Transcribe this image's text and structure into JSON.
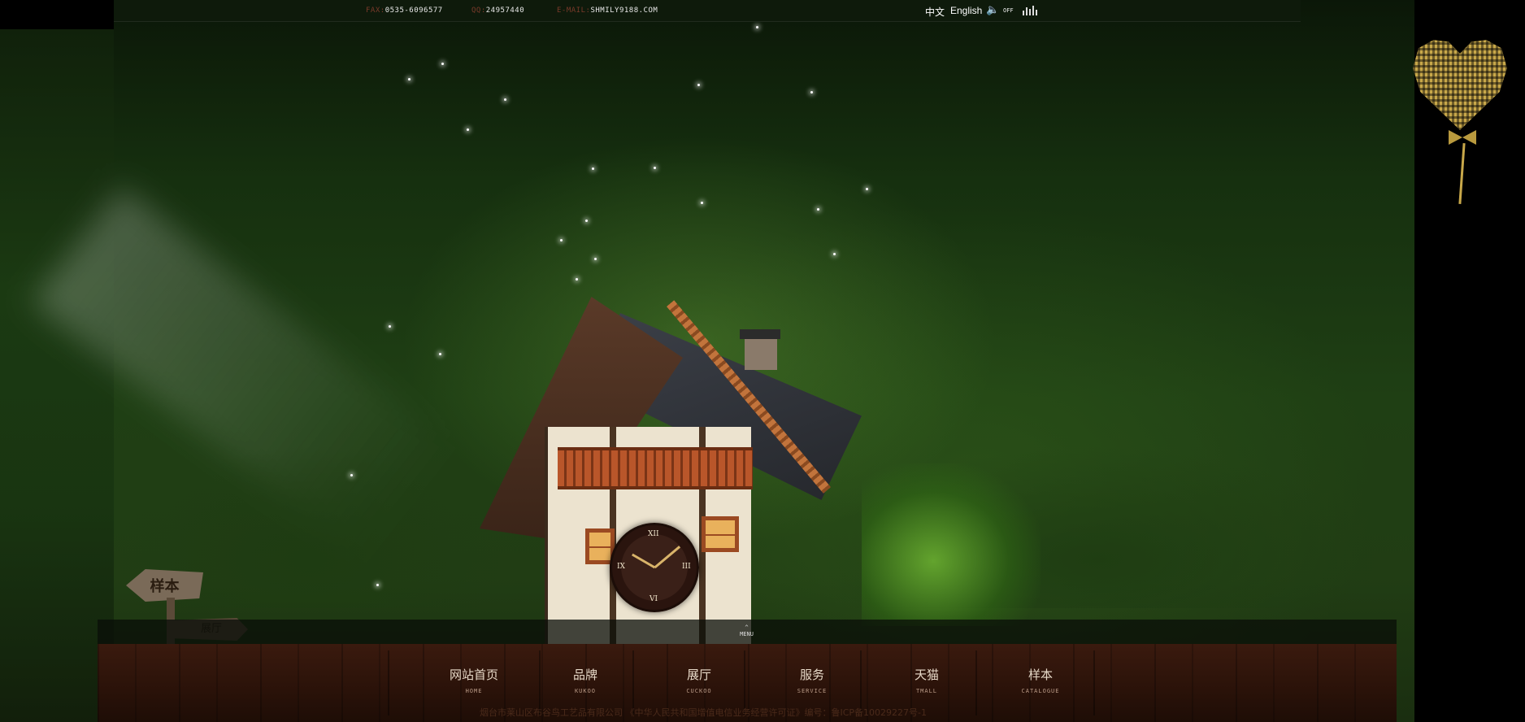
{
  "topbar": {
    "fax_label": "FAX:",
    "fax_value": "0535-6096577",
    "qq_label": "QQ:",
    "qq_value": "24957440",
    "email_label": "E-MAIL:",
    "email_value": "SHMILY9188.COM",
    "lang_cn": "中文",
    "lang_en": "English",
    "sound_label": "OFF"
  },
  "menu_toggle": {
    "arrow": "^",
    "label": "MENU"
  },
  "nav": {
    "items": [
      {
        "cn": "网站首页",
        "en": "HOME"
      },
      {
        "cn": "品牌",
        "en": "KUKOO"
      },
      {
        "cn": "展厅",
        "en": "CUCKOO"
      },
      {
        "cn": "服务",
        "en": "SERVICE"
      },
      {
        "cn": "天猫",
        "en": "TMALL"
      },
      {
        "cn": "样本",
        "en": "CATALOGUE"
      }
    ]
  },
  "signpost": {
    "top": "样本",
    "bottom": "展厅"
  },
  "clock": {
    "numerals": [
      "XII",
      "III",
      "VI",
      "IX"
    ]
  },
  "footer": {
    "text": "烟台市莱山区布谷鸟工艺品有限公司    《中华人民共和国增值电信业务经营许可证》编号：鲁ICP备10029227号-1"
  },
  "icons": {
    "sound": "speaker-icon",
    "equalizer": "equalizer-icon",
    "qr": "qr-code-balloon"
  },
  "colors": {
    "forest": "#1f3f14",
    "wood": "#2a1209",
    "accent_label": "#7a3a2a"
  }
}
